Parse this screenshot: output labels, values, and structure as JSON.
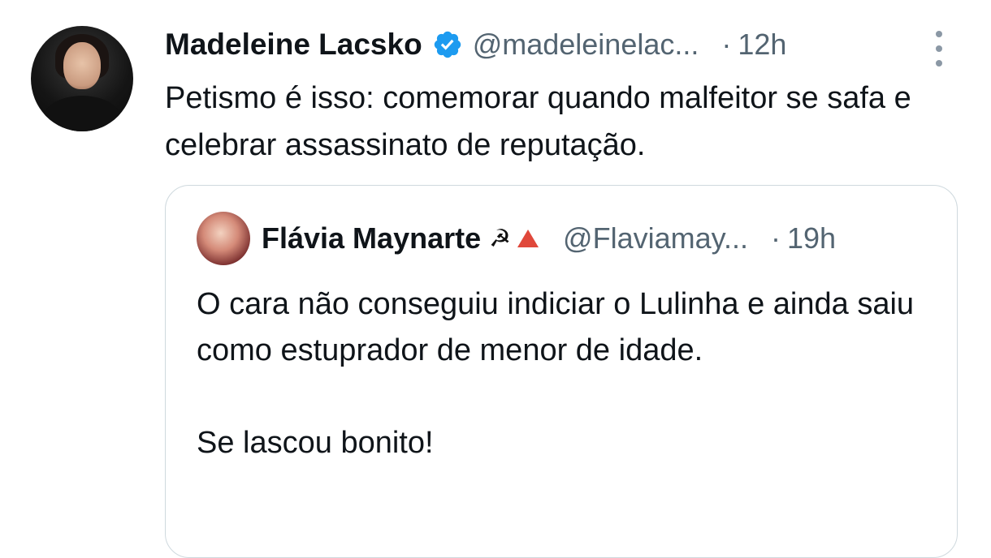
{
  "tweet": {
    "author_name": "Madeleine Lacsko",
    "verified_icon": "verified-badge-icon",
    "handle": "@madeleinelac...",
    "separator": "·",
    "time": "12h",
    "text": "Petismo é isso: comemorar quando malfeitor se safa e celebrar assassinato de reputação."
  },
  "quote": {
    "author_name": "Flávia Maynarte",
    "emoji_1": "☭",
    "emoji_2_icon": "red-triangle-icon",
    "handle": "@Flaviamay...",
    "separator": "·",
    "time": "19h",
    "text_line_1": "O cara não conseguiu indiciar o Lulinha e ainda saiu como estuprador de menor de idade.",
    "text_line_2": "Se lascou bonito!"
  },
  "colors": {
    "text": "#0f1419",
    "secondary": "#536471",
    "verified": "#1d9bf0",
    "border": "#cfd9de"
  }
}
